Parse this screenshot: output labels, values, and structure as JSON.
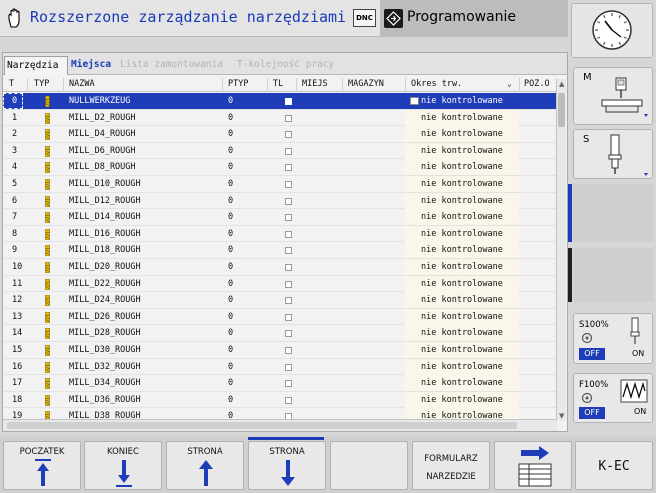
{
  "header": {
    "title": "Rozszerzone zarządzanie narzędziami",
    "dnc_badge": "DNC",
    "mode": "Programowanie"
  },
  "tabs": [
    {
      "label": "Narzędzia",
      "state": "active"
    },
    {
      "label": "Miejsca",
      "state": "enabled"
    },
    {
      "label": "Lista zamontowania",
      "state": "disabled"
    },
    {
      "label": "T-kolejność pracy",
      "state": "disabled"
    }
  ],
  "columns": [
    "T",
    "TYP",
    "NAZWA",
    "PTYP",
    "TL",
    "MIEJS",
    "MAGAZYN",
    "Okres trw.",
    "POZ.O"
  ],
  "rows": [
    {
      "t": "0",
      "name": "NULLWERKZEUG",
      "ptyp": "0",
      "okres": "nie kontrolowane"
    },
    {
      "t": "1",
      "name": "MILL_D2_ROUGH",
      "ptyp": "0",
      "okres": "nie kontrolowane"
    },
    {
      "t": "2",
      "name": "MILL_D4_ROUGH",
      "ptyp": "0",
      "okres": "nie kontrolowane"
    },
    {
      "t": "3",
      "name": "MILL_D6_ROUGH",
      "ptyp": "0",
      "okres": "nie kontrolowane"
    },
    {
      "t": "4",
      "name": "MILL_D8_ROUGH",
      "ptyp": "0",
      "okres": "nie kontrolowane"
    },
    {
      "t": "5",
      "name": "MILL_D10_ROUGH",
      "ptyp": "0",
      "okres": "nie kontrolowane"
    },
    {
      "t": "6",
      "name": "MILL_D12_ROUGH",
      "ptyp": "0",
      "okres": "nie kontrolowane"
    },
    {
      "t": "7",
      "name": "MILL_D14_ROUGH",
      "ptyp": "0",
      "okres": "nie kontrolowane"
    },
    {
      "t": "8",
      "name": "MILL_D16_ROUGH",
      "ptyp": "0",
      "okres": "nie kontrolowane"
    },
    {
      "t": "9",
      "name": "MILL_D18_ROUGH",
      "ptyp": "0",
      "okres": "nie kontrolowane"
    },
    {
      "t": "10",
      "name": "MILL_D20_ROUGH",
      "ptyp": "0",
      "okres": "nie kontrolowane"
    },
    {
      "t": "11",
      "name": "MILL_D22_ROUGH",
      "ptyp": "0",
      "okres": "nie kontrolowane"
    },
    {
      "t": "12",
      "name": "MILL_D24_ROUGH",
      "ptyp": "0",
      "okres": "nie kontrolowane"
    },
    {
      "t": "13",
      "name": "MILL_D26_ROUGH",
      "ptyp": "0",
      "okres": "nie kontrolowane"
    },
    {
      "t": "14",
      "name": "MILL_D28_ROUGH",
      "ptyp": "0",
      "okres": "nie kontrolowane"
    },
    {
      "t": "15",
      "name": "MILL_D30_ROUGH",
      "ptyp": "0",
      "okres": "nie kontrolowane"
    },
    {
      "t": "16",
      "name": "MILL_D32_ROUGH",
      "ptyp": "0",
      "okres": "nie kontrolowane"
    },
    {
      "t": "17",
      "name": "MILL_D34_ROUGH",
      "ptyp": "0",
      "okres": "nie kontrolowane"
    },
    {
      "t": "18",
      "name": "MILL_D36_ROUGH",
      "ptyp": "0",
      "okres": "nie kontrolowane"
    },
    {
      "t": "19",
      "name": "MILL_D38_ROUGH",
      "ptyp": "0",
      "okres": "nie kontrolowane"
    }
  ],
  "selected_row": 0,
  "side_softkeys": {
    "m_label": "M",
    "s_label": "S",
    "s_override": "S100%",
    "f_override": "F100%",
    "off": "OFF",
    "on": "ON"
  },
  "softkeys": {
    "start": "POCZATEK",
    "end": "KONIEC",
    "page_up": "STRONA",
    "page_down": "STRONA",
    "form_line1": "FORMULARZ",
    "form_line2": "NARZEDZIE",
    "kec": "K-EC"
  },
  "colors": {
    "accent": "#1f3db8",
    "tool_icon": "#e0b800"
  }
}
